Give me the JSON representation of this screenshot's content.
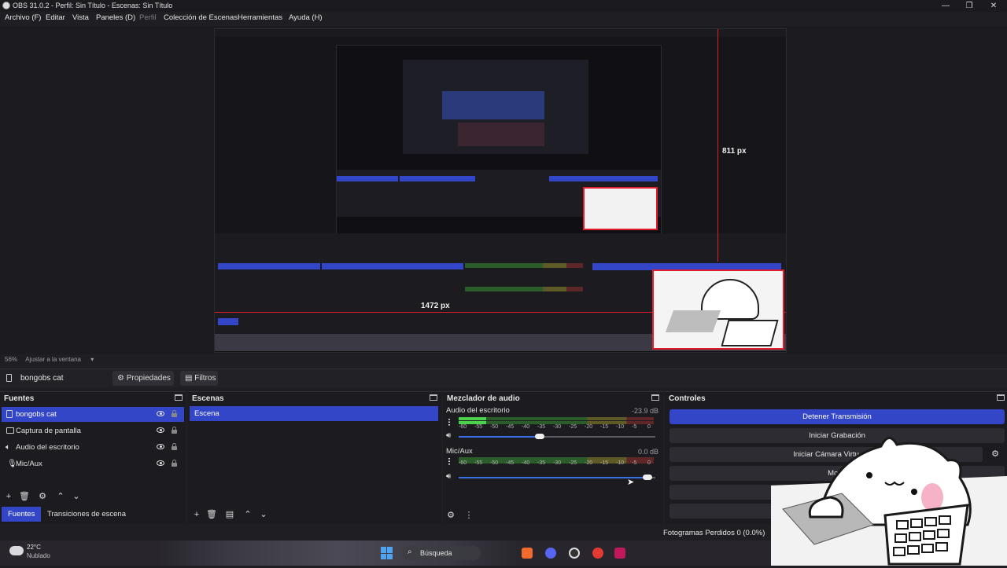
{
  "window": {
    "title": "OBS 31.0.2 - Perfil: Sin Título - Escenas: Sin Título",
    "minimize_glyph": "—",
    "maximize_glyph": "❐",
    "close_glyph": "✕"
  },
  "menu": [
    "Archivo (F)",
    "Editar",
    "Vista",
    "Paneles (D)",
    "Perfil",
    "Colección de Escenas",
    "Herramientas",
    "Ayuda (H)"
  ],
  "preview": {
    "height_label": "811 px",
    "width_label": "1472 px",
    "zoom": "56%",
    "fit_label": "Ajustar a la ventana"
  },
  "source_toolbar": {
    "current_source": "bongobs cat",
    "properties_label": "Propiedades",
    "filters_label": "Filtros"
  },
  "sources_dock": {
    "title": "Fuentes",
    "items": [
      "bongobs cat",
      "Captura de pantalla",
      "Audio del escritorio",
      "Mic/Aux"
    ],
    "tab_active": "Fuentes",
    "tab_other": "Transiciones de escena"
  },
  "scenes_dock": {
    "title": "Escenas",
    "items": [
      "Escena"
    ]
  },
  "mixer_dock": {
    "title": "Mezclador de audio",
    "ticks": [
      "-60",
      "-55",
      "-50",
      "-45",
      "-40",
      "-35",
      "-30",
      "-25",
      "-20",
      "-15",
      "-10",
      "-5",
      "0"
    ],
    "channels": [
      {
        "name": "Audio del escritorio",
        "db": "-23.9 dB",
        "level": 0.14,
        "volume": 0.41
      },
      {
        "name": "Mic/Aux",
        "db": "0.0 dB",
        "level": 0.0,
        "volume": 0.96
      }
    ]
  },
  "controls_dock": {
    "title": "Controles",
    "buttons": [
      "Detener Transmisión",
      "Iniciar Grabación",
      "Iniciar Cámara Virtu",
      "Modo",
      "",
      ""
    ]
  },
  "status": {
    "dropped_frames": "Fotogramas Perdidos 0 (0.0%)"
  },
  "taskbar": {
    "temperature": "22°C",
    "condition": "Nublado",
    "search": "Búsqueda"
  },
  "colors": {
    "accent": "#3346c7",
    "guide_red": "#e11d2b",
    "meter_green": "#4bd14b"
  }
}
